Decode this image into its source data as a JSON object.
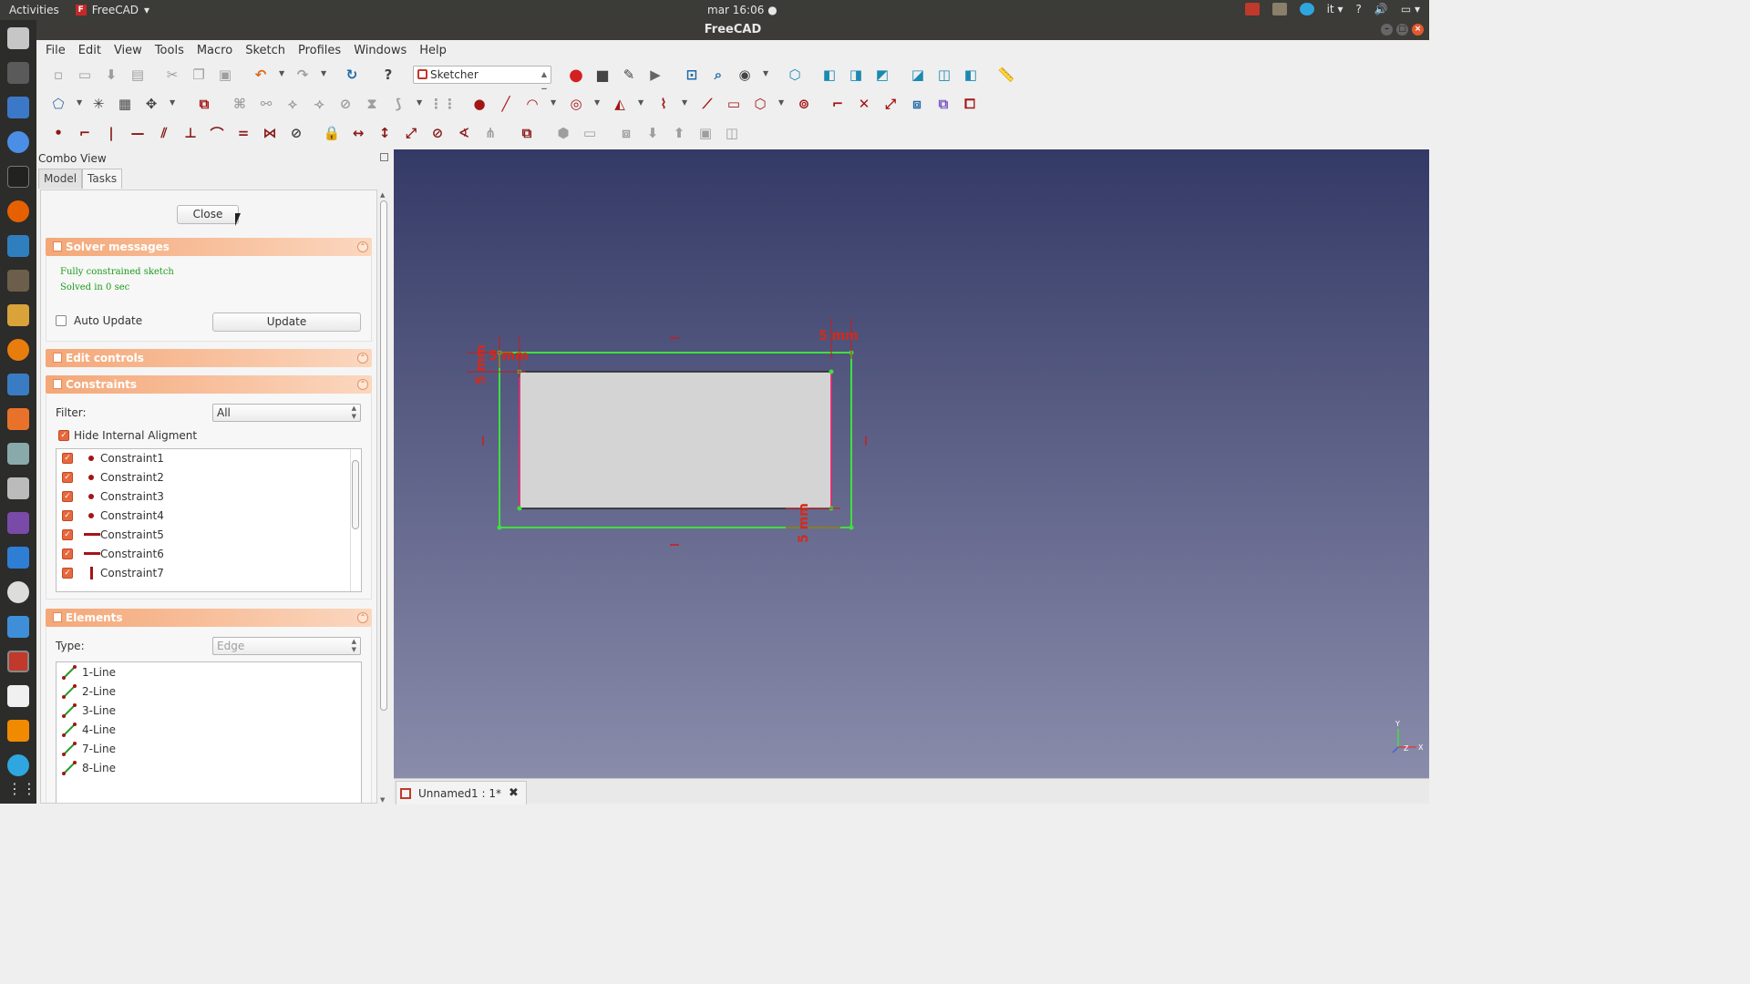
{
  "topbar": {
    "activities": "Activities",
    "app_name": "FreeCAD",
    "clock": "mar 16:06",
    "lang": "it",
    "help": "?"
  },
  "window": {
    "title": "FreeCAD"
  },
  "menu": [
    "File",
    "Edit",
    "View",
    "Tools",
    "Macro",
    "Sketch",
    "Profiles",
    "Windows",
    "Help"
  ],
  "toolbar": {
    "workbench": "Sketcher"
  },
  "combo": {
    "title": "Combo View",
    "tabs": [
      "Model",
      "Tasks"
    ],
    "active_tab": "Tasks"
  },
  "tasks": {
    "close_label": "Close",
    "solver": {
      "title": "Solver messages",
      "line1": "Fully constrained sketch",
      "line2": "Solved in 0 sec",
      "auto_update_label": "Auto Update",
      "auto_update_checked": false,
      "update_label": "Update"
    },
    "edit_controls": {
      "title": "Edit controls"
    },
    "constraints": {
      "title": "Constraints",
      "filter_label": "Filter:",
      "filter_value": "All",
      "hide_internal_label": "Hide Internal Aligment",
      "hide_internal_checked": true,
      "items": [
        {
          "name": "Constraint1",
          "kind": "point"
        },
        {
          "name": "Constraint2",
          "kind": "point"
        },
        {
          "name": "Constraint3",
          "kind": "point"
        },
        {
          "name": "Constraint4",
          "kind": "point"
        },
        {
          "name": "Constraint5",
          "kind": "horizontal"
        },
        {
          "name": "Constraint6",
          "kind": "horizontal"
        },
        {
          "name": "Constraint7",
          "kind": "vertical"
        }
      ]
    },
    "elements": {
      "title": "Elements",
      "type_label": "Type:",
      "type_value": "Edge",
      "items": [
        "1-Line",
        "2-Line",
        "3-Line",
        "4-Line",
        "7-Line",
        "8-Line"
      ]
    }
  },
  "view3d": {
    "dim_labels": [
      "5 mm",
      "5 mm",
      "5 mm",
      "5 mm"
    ],
    "axis_labels": [
      "Y",
      "Z",
      "X"
    ]
  },
  "document": {
    "tab_label": "Unnamed1 : 1*"
  },
  "colors": {
    "panel_header": "#f4a777",
    "sketch_green": "#33dd33",
    "constraint_red": "#cc1a1a",
    "bg_top": "#343a66",
    "bg_bottom": "#8a8cab"
  }
}
